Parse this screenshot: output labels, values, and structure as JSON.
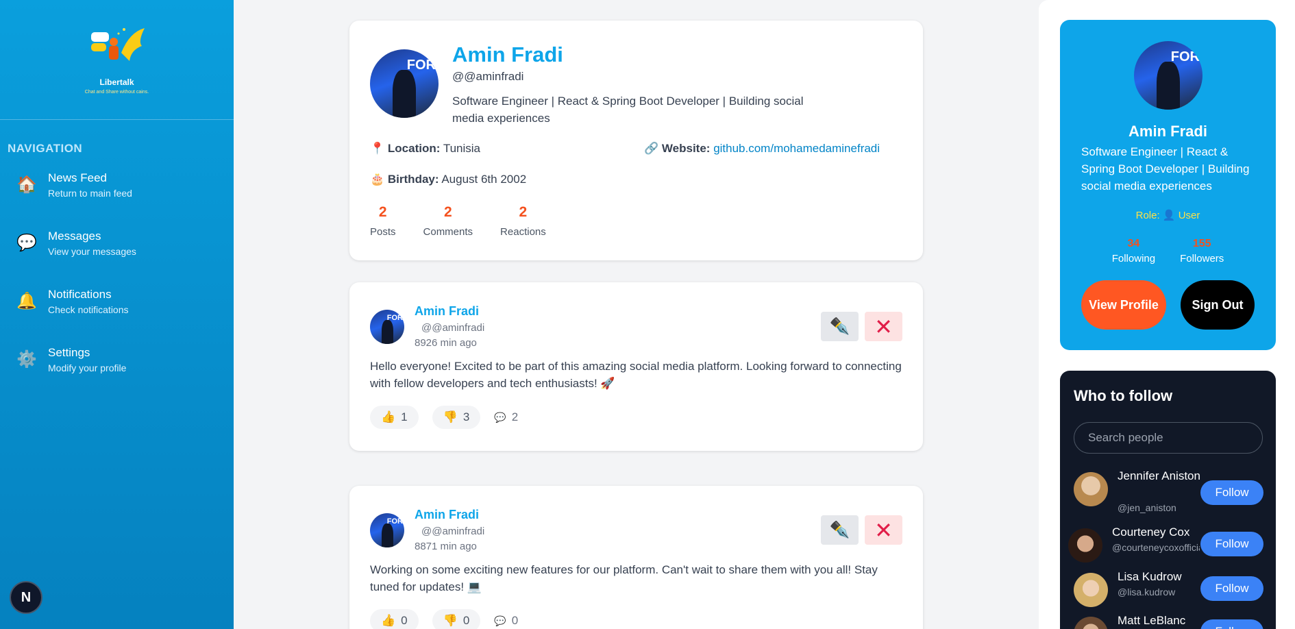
{
  "brand": {
    "name": "Libertalk",
    "tagline": "Chat and Share without cains."
  },
  "navigation": {
    "title": "NAVIGATION",
    "items": [
      {
        "icon": "house-icon",
        "glyph": "🏠",
        "label": "News Feed",
        "sub": "Return to main feed"
      },
      {
        "icon": "speech-bubble-icon",
        "glyph": "💬",
        "label": "Messages",
        "sub": "View your messages"
      },
      {
        "icon": "bell-icon",
        "glyph": "🔔",
        "label": "Notifications",
        "sub": "Check notifications"
      },
      {
        "icon": "gear-icon",
        "glyph": "⚙️",
        "label": "Settings",
        "sub": "Modify your profile"
      }
    ]
  },
  "dev_badge": "N",
  "profile": {
    "name": "Amin Fradi",
    "handle": "@@aminfradi",
    "bio": "Software Engineer | React & Spring Boot Developer | Building social media experiences",
    "location_label": "Location:",
    "location": "Tunisia",
    "website_label": "Website:",
    "website": "github.com/mohamedaminefradi",
    "birthday_label": "Birthday:",
    "birthday": "August 6th 2002",
    "stats": [
      {
        "value": "2",
        "label": "Posts"
      },
      {
        "value": "2",
        "label": "Comments"
      },
      {
        "value": "2",
        "label": "Reactions"
      }
    ]
  },
  "posts": [
    {
      "author": "Amin Fradi",
      "handle": "@@aminfradi",
      "time": "8926 min ago",
      "text": "Hello everyone! Excited to be part of this amazing social media platform. Looking forward to connecting with fellow developers and tech enthusiasts! 🚀",
      "likes": "1",
      "dislikes": "3",
      "comments": "2"
    },
    {
      "author": "Amin Fradi",
      "handle": "@@aminfradi",
      "time": "8871 min ago",
      "text": "Working on some exciting new features for our platform. Can't wait to share them with you all! Stay tuned for updates! 💻",
      "likes": "0",
      "dislikes": "0",
      "comments": "0"
    }
  ],
  "user_card": {
    "name": "Amin Fradi",
    "bio": "Software Engineer | React & Spring Boot Developer | Building social media experiences",
    "role_label": "Role:",
    "role": "User",
    "following": "34",
    "following_label": "Following",
    "followers": "155",
    "followers_label": "Followers",
    "view_profile": "View Profile",
    "sign_out": "Sign Out"
  },
  "who_to_follow": {
    "title": "Who to follow",
    "search_placeholder": "Search people",
    "follow_label": "Follow",
    "people": [
      {
        "name": "Jennifer Aniston",
        "handle": "@jen_aniston"
      },
      {
        "name": "Courteney Cox",
        "handle": "@courteneycoxofficial"
      },
      {
        "name": "Lisa Kudrow",
        "handle": "@lisa.kudrow"
      },
      {
        "name": "Matt LeBlanc",
        "handle": ""
      }
    ]
  },
  "colors": {
    "primary": "#0ea5e9",
    "accent": "#ff5722",
    "stat": "#f4511e",
    "follow": "#3b82f6",
    "dark": "#111827"
  }
}
